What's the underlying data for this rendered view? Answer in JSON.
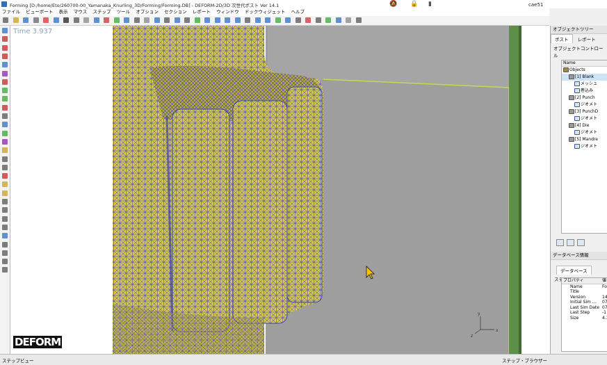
{
  "window": {
    "title": "Forming [D:/home/Eto/260700-00_Yamanaka_Knurling_3D/Forming/Forming.DB] - DEFORM-2D/3D 次世代ポスト Ver 14.1",
    "user": "cae51"
  },
  "menu": [
    "ファイル",
    "ビューポート",
    "表示",
    "マウス",
    "ステップ",
    "ツール",
    "オプション",
    "セクション",
    "レポート",
    "ウィンドウ",
    "ドックウィジェット",
    "ヘルプ"
  ],
  "viewport": {
    "time_label": "Time 3.937",
    "logo_text": "DEFORM",
    "axis": {
      "x": "x",
      "y": "y",
      "z": "z"
    }
  },
  "object_tree": {
    "title": "オブジェクトツリー",
    "tabs": [
      "ポスト",
      "レポート"
    ],
    "control_label": "オブジェクトコントロール",
    "column": "Name",
    "items": [
      {
        "label": "Objects",
        "level": 0
      },
      {
        "label": "[1] Blank",
        "level": 1
      },
      {
        "label": "メッシュ",
        "level": 2
      },
      {
        "label": "巻込み",
        "level": 2
      },
      {
        "label": "[2] Punch",
        "level": 1
      },
      {
        "label": "ジオメト",
        "level": 2
      },
      {
        "label": "[3] PunchD",
        "level": 1
      },
      {
        "label": "ジオメト",
        "level": 2
      },
      {
        "label": "[4] Die",
        "level": 1
      },
      {
        "label": "ジオメト",
        "level": 2
      },
      {
        "label": "[5] Mandre",
        "level": 1
      },
      {
        "label": "ジオメト",
        "level": 2
      }
    ]
  },
  "database": {
    "title": "データベース情報",
    "tabs": [
      "データベース",
      "ステップ"
    ],
    "header": [
      "プロパティ",
      "値"
    ],
    "rows": [
      {
        "k": "Name",
        "v": "Fo"
      },
      {
        "k": "Title",
        "v": ""
      },
      {
        "k": "Version",
        "v": "14"
      },
      {
        "k": "Initial Sim ...",
        "v": "07"
      },
      {
        "k": "Last Sim Date",
        "v": "07"
      },
      {
        "k": "Last Step",
        "v": "-1"
      },
      {
        "k": "Size",
        "v": "4.3"
      }
    ]
  },
  "status": {
    "left": "ステップビュー",
    "right": "ステップ・ブラウザー"
  },
  "colors": {
    "mesh_fill": "#d7c84a",
    "mesh_line": "#3b3fc0",
    "die_gray": "#9e9e9e",
    "die_edge": "#6aa84f"
  }
}
